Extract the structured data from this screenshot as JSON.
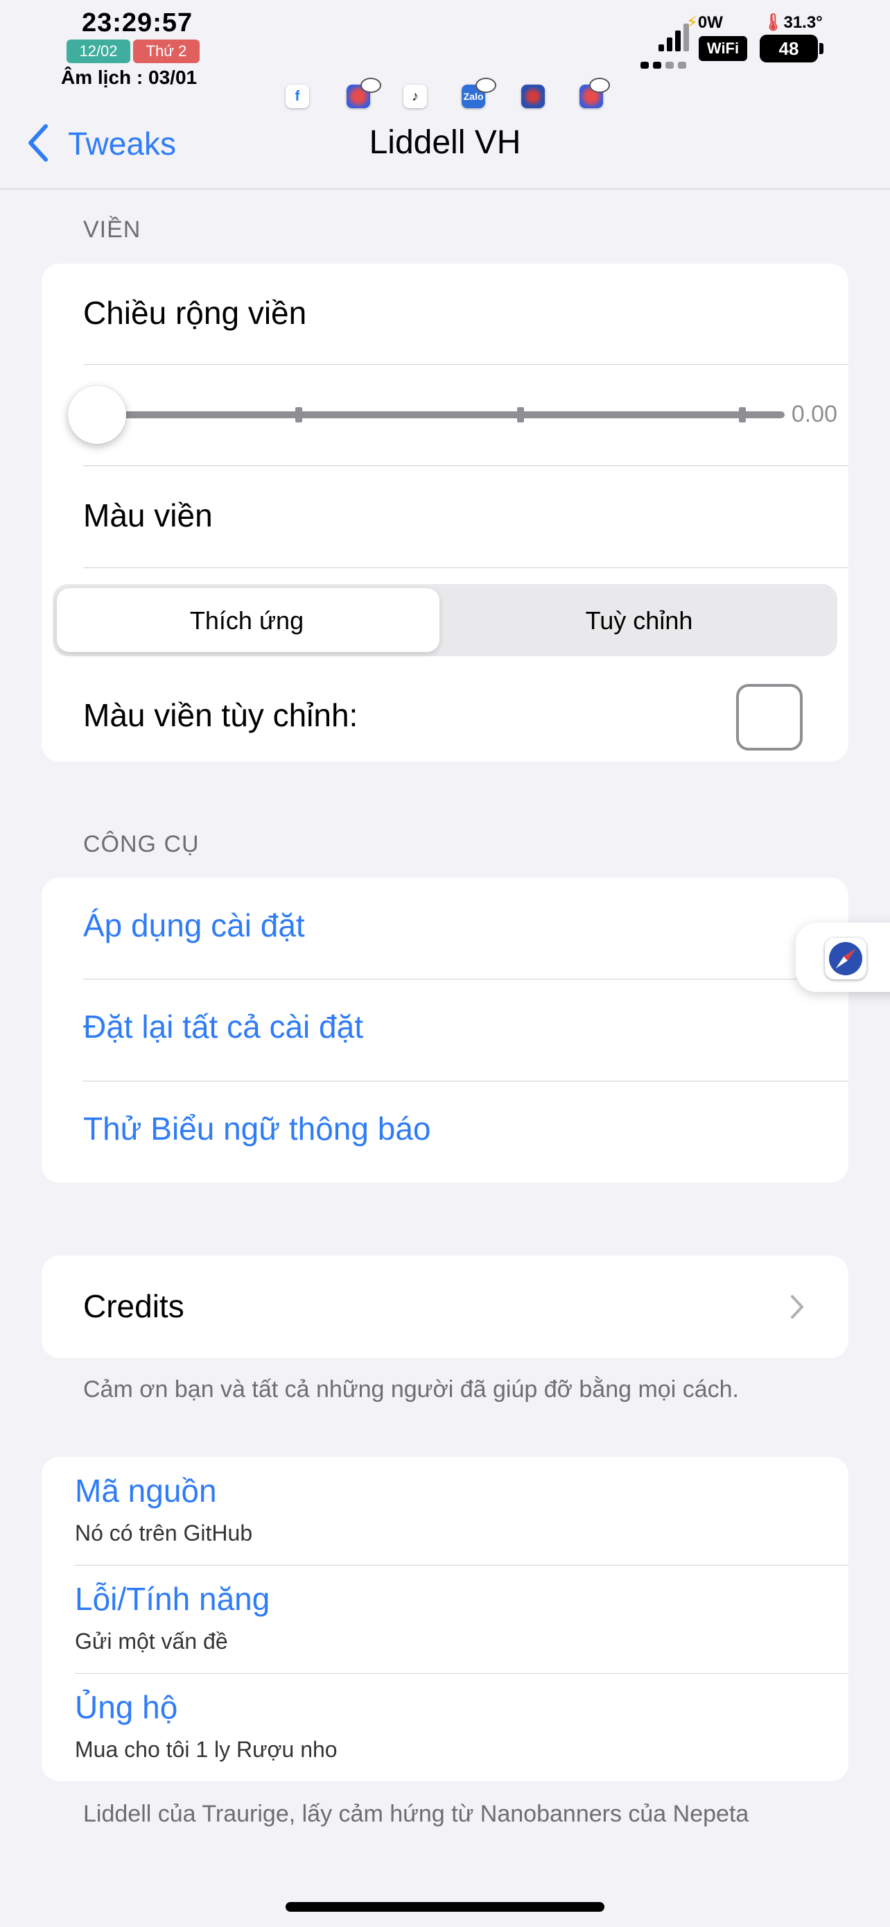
{
  "status": {
    "time": "23:29:57",
    "date": "12/02",
    "weekday": "Thứ 2",
    "lunar": "Âm lịch : 03/01",
    "power": "0W",
    "temperature": "31.3°",
    "wifi": "WiFi",
    "battery": "48",
    "colors": {
      "date_badge": "#3fae9e",
      "weekday_badge": "#e06060"
    },
    "app_icons": [
      "facebook-icon",
      "messenger-icon",
      "tiktok-icon",
      "zalo-icon",
      "safari-icon",
      "messenger-lite-icon"
    ],
    "zalo_label": "Zalo",
    "facebook_glyph": "f",
    "tiktok_glyph": "♪"
  },
  "nav": {
    "back_label": "Tweaks",
    "title": "Liddell VH"
  },
  "border_section": {
    "header": "VIỀN",
    "width_label": "Chiều rộng viền",
    "slider_value": "0.00",
    "slider_fraction": 0,
    "color_label": "Màu viền",
    "segments": [
      "Thích ứng",
      "Tuỳ chỉnh"
    ],
    "selected_segment": 0,
    "custom_color_label": "Màu viền tùy chỉnh:"
  },
  "tools_section": {
    "header": "CÔNG CỤ",
    "items": [
      "Áp dụng cài đặt",
      "Đặt lại tất cả cài đặt",
      "Thử Biểu ngữ thông báo"
    ]
  },
  "credits": {
    "label": "Credits",
    "footer": "Cảm ơn bạn và tất cả những người đã giúp đỡ bằng mọi cách."
  },
  "links": {
    "items": [
      {
        "title": "Mã nguồn",
        "subtitle": "Nó có trên GitHub"
      },
      {
        "title": "Lỗi/Tính năng",
        "subtitle": "Gửi một vấn đề"
      },
      {
        "title": "Ủng hộ",
        "subtitle": "Mua cho tôi 1 ly Rượu nho"
      }
    ],
    "footer": "Liddell của Traurige, lấy cảm hứng từ Nanobanners của Nepeta"
  },
  "accent_color": "#2f7cf6"
}
